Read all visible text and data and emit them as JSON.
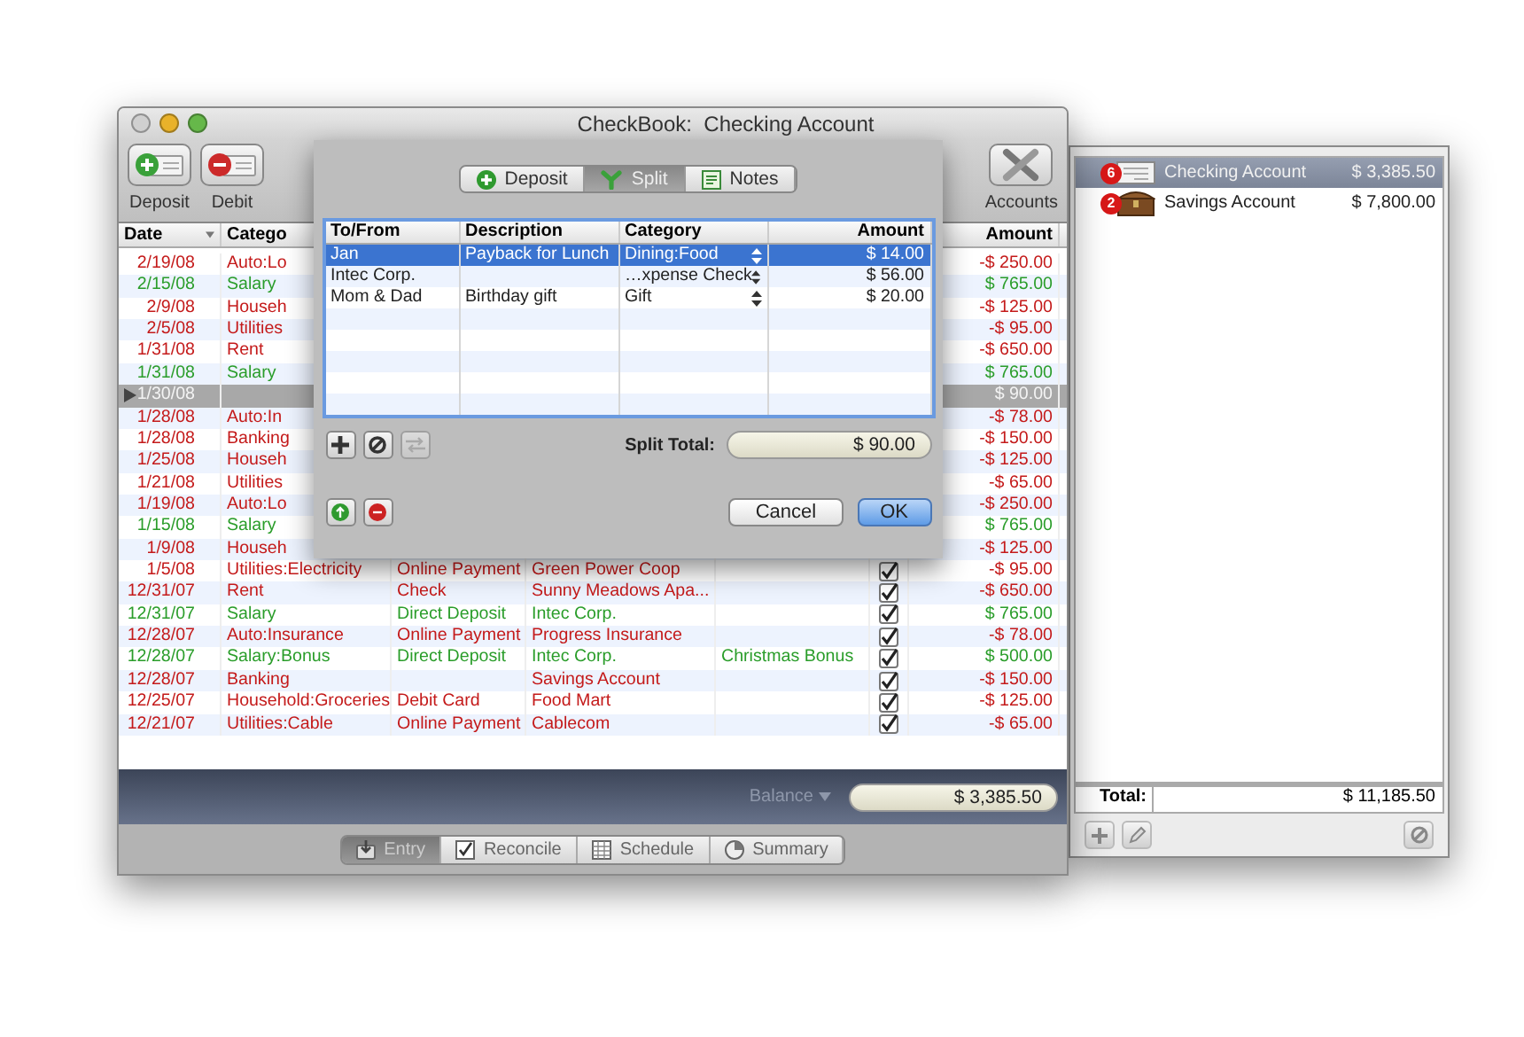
{
  "main_window": {
    "title": "CheckBook:  Checking Account",
    "toolbar": [
      {
        "label": "Deposit",
        "kind": "deposit"
      },
      {
        "label": "Debit",
        "kind": "debit"
      },
      {
        "label": "Accounts",
        "kind": "accounts"
      }
    ],
    "table": {
      "columns": [
        "Date",
        "Catego",
        "Amount"
      ],
      "rows": [
        {
          "date": "2/19/08",
          "category": "Auto:Lo",
          "amount": "-$ 250.00",
          "kind": "payment",
          "selected": false
        },
        {
          "date": "2/15/08",
          "category": "Salary",
          "amount": "$ 765.00",
          "kind": "deposit",
          "selected": false
        },
        {
          "date": "2/9/08",
          "category": "Househ",
          "amount": "-$ 125.00",
          "kind": "payment",
          "selected": false
        },
        {
          "date": "2/5/08",
          "category": "Utilities",
          "amount": "-$ 95.00",
          "kind": "payment",
          "selected": false
        },
        {
          "date": "1/31/08",
          "category": "Rent",
          "amount": "-$ 650.00",
          "kind": "payment",
          "selected": false
        },
        {
          "date": "1/31/08",
          "category": "Salary",
          "amount": "$ 765.00",
          "kind": "deposit",
          "selected": false
        },
        {
          "date": "1/30/08",
          "amount": "$ 90.00",
          "kind": "split",
          "selected": true
        },
        {
          "date": "1/28/08",
          "category": "Auto:In",
          "amount": "-$ 78.00",
          "kind": "payment",
          "selected": false
        },
        {
          "date": "1/28/08",
          "category": "Banking",
          "amount": "-$ 150.00",
          "kind": "payment",
          "selected": false
        },
        {
          "date": "1/25/08",
          "category": "Househ",
          "amount": "-$ 125.00",
          "kind": "payment",
          "selected": false
        },
        {
          "date": "1/21/08",
          "category": "Utilities",
          "amount": "-$ 65.00",
          "kind": "payment",
          "selected": false
        },
        {
          "date": "1/19/08",
          "category": "Auto:Lo",
          "amount": "-$ 250.00",
          "kind": "payment",
          "selected": false
        },
        {
          "date": "1/15/08",
          "category": "Salary",
          "amount": "$ 765.00",
          "kind": "deposit",
          "selected": false
        },
        {
          "date": "1/9/08",
          "category": "Househ",
          "amount": "-$ 125.00",
          "kind": "payment",
          "selected": false
        },
        {
          "date": "1/5/08",
          "category": "Utilities:Electricity",
          "column_3": "Online Payment",
          "column_4": "Green Power Coop",
          "checked": true,
          "amount": "-$ 95.00",
          "kind": "payment",
          "selected": false
        },
        {
          "date": "12/31/07",
          "category": "Rent",
          "column_3": "Check",
          "column_4": "Sunny Meadows Apa...",
          "checked": true,
          "amount": "-$ 650.00",
          "kind": "payment",
          "selected": false
        },
        {
          "date": "12/31/07",
          "category": "Salary",
          "column_3": "Direct Deposit",
          "column_4": "Intec Corp.",
          "checked": true,
          "amount": "$ 765.00",
          "kind": "deposit",
          "selected": false
        },
        {
          "date": "12/28/07",
          "category": "Auto:Insurance",
          "column_3": "Online Payment",
          "column_4": "Progress Insurance",
          "checked": true,
          "amount": "-$ 78.00",
          "kind": "payment",
          "selected": false
        },
        {
          "date": "12/28/07",
          "category": "Salary:Bonus",
          "column_3": "Direct Deposit",
          "column_4": "Intec Corp.",
          "column_5": "Christmas Bonus",
          "checked": true,
          "amount": "$ 500.00",
          "kind": "deposit",
          "selected": false
        },
        {
          "date": "12/28/07",
          "category": "Banking",
          "column_4": "Savings Account",
          "checked": true,
          "amount": "-$ 150.00",
          "kind": "payment",
          "selected": false
        },
        {
          "date": "12/25/07",
          "category": "Household:Groceries",
          "column_3": "Debit Card",
          "column_4": "Food Mart",
          "checked": true,
          "amount": "-$ 125.00",
          "kind": "payment",
          "selected": false
        },
        {
          "date": "12/21/07",
          "category": "Utilities:Cable",
          "column_3": "Online Payment",
          "column_4": "Cablecom",
          "checked": true,
          "amount": "-$ 65.00",
          "kind": "payment",
          "selected": false
        }
      ]
    },
    "balance": {
      "label": "Balance",
      "value": "$ 3,385.50"
    },
    "view_tabs": [
      {
        "label": "Entry",
        "kind": "entry",
        "selected": true
      },
      {
        "label": "Reconcile",
        "kind": "reconcile",
        "selected": false
      },
      {
        "label": "Schedule",
        "kind": "schedule",
        "selected": false
      },
      {
        "label": "Summary",
        "kind": "summary",
        "selected": false
      }
    ]
  },
  "sheet": {
    "tabs": [
      {
        "label": "Deposit",
        "kind": "deposit",
        "selected": false
      },
      {
        "label": "Split",
        "kind": "split",
        "selected": true
      },
      {
        "label": "Notes",
        "kind": "notes",
        "selected": false
      }
    ],
    "columns": [
      "To/From",
      "Description",
      "Category",
      "Amount"
    ],
    "rows": [
      {
        "to_from": "Jan",
        "description": "Payback for Lunch",
        "category": "Dining:Food",
        "amount": "$ 14.00",
        "selected": true
      },
      {
        "to_from": "Intec Corp.",
        "category": "…xpense Check",
        "amount": "$ 56.00",
        "selected": false
      },
      {
        "to_from": "Mom & Dad",
        "description": "Birthday gift",
        "category": "Gift",
        "amount": "$ 20.00",
        "selected": false
      }
    ],
    "row_buttons": [
      {
        "kind": "add",
        "disabled": false
      },
      {
        "kind": "remove",
        "disabled": false
      },
      {
        "kind": "transfer",
        "disabled": true
      }
    ],
    "split_total": {
      "label": "Split Total:",
      "value": "$ 90.00"
    },
    "type_buttons": [
      {
        "kind": "deposit"
      },
      {
        "kind": "debit"
      }
    ],
    "buttons": [
      {
        "label": "Cancel",
        "default": false
      },
      {
        "label": "OK",
        "default": true
      }
    ]
  },
  "accounts_window": {
    "accounts": [
      {
        "name": "Checking Account",
        "balance": "$ 3,385.50",
        "badge": "6",
        "kind": "checking",
        "selected": true
      },
      {
        "name": "Savings Account",
        "balance": "$ 7,800.00",
        "badge": "2",
        "kind": "savings",
        "selected": false
      }
    ],
    "total": {
      "label": "Total:",
      "value": "$ 11,185.50"
    }
  }
}
